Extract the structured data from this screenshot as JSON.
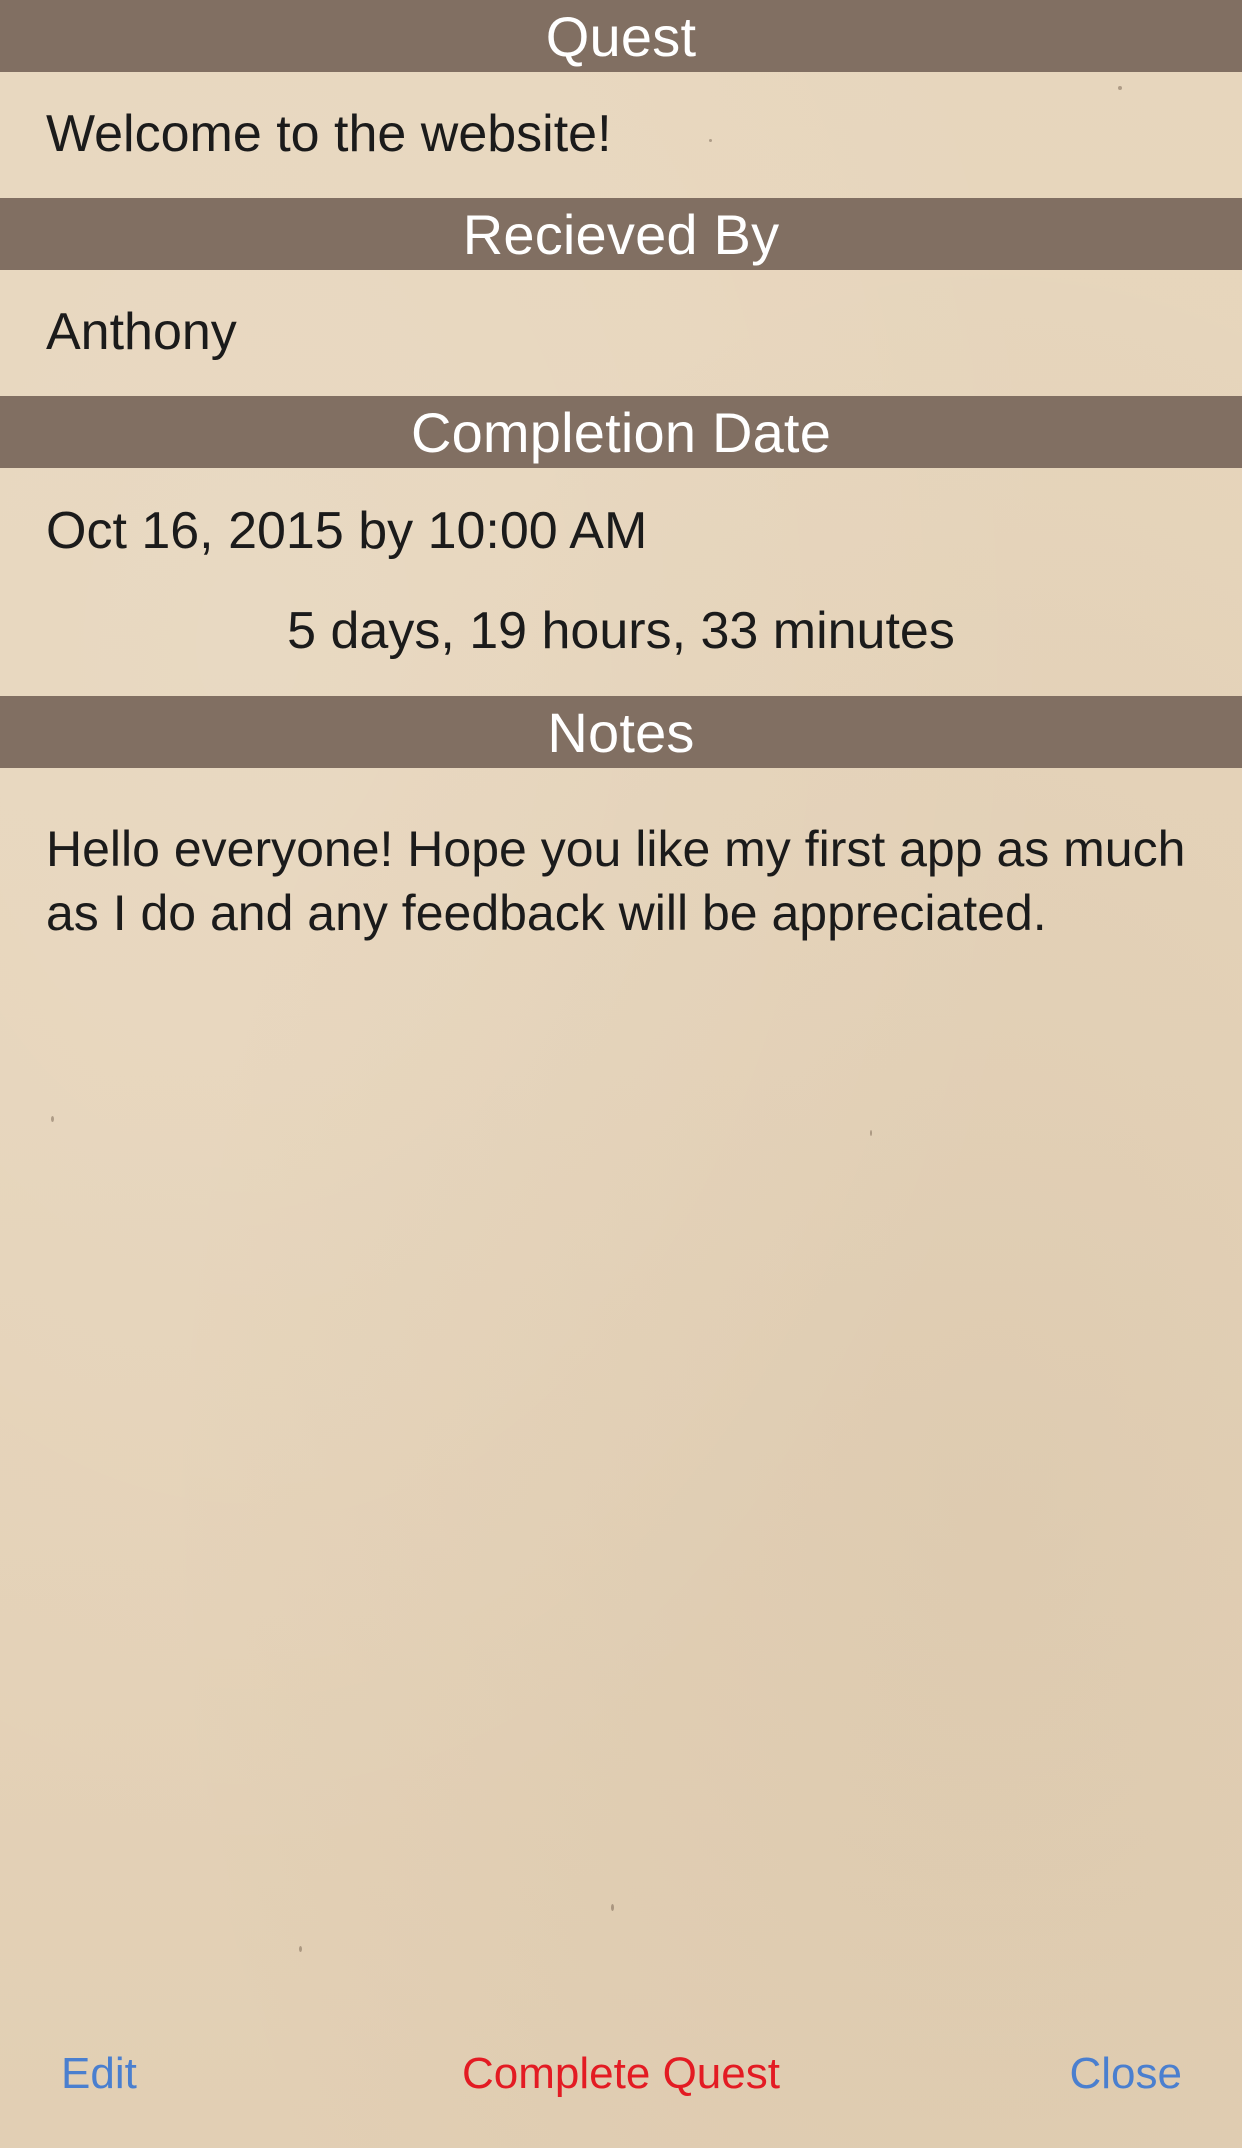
{
  "colors": {
    "header_bg": "#816f62",
    "header_text": "#ffffff",
    "body_text": "#1b1b1b",
    "link_blue": "#4a7fcf",
    "danger_red": "#e31b23",
    "paper": "#e6d4ba"
  },
  "sections": {
    "quest": {
      "header": "Quest",
      "value": "Welcome to the website!"
    },
    "received_by": {
      "header": "Recieved By",
      "value": "Anthony"
    },
    "completion_date": {
      "header": "Completion Date",
      "value": "Oct 16, 2015 by 10:00 AM",
      "countdown": "5 days, 19 hours, 33 minutes"
    },
    "notes": {
      "header": "Notes",
      "value": "Hello everyone! Hope you like my first app as much as I do and any feedback will be appreciated."
    }
  },
  "actions": {
    "edit_label": "Edit",
    "complete_label": "Complete Quest",
    "close_label": "Close"
  }
}
